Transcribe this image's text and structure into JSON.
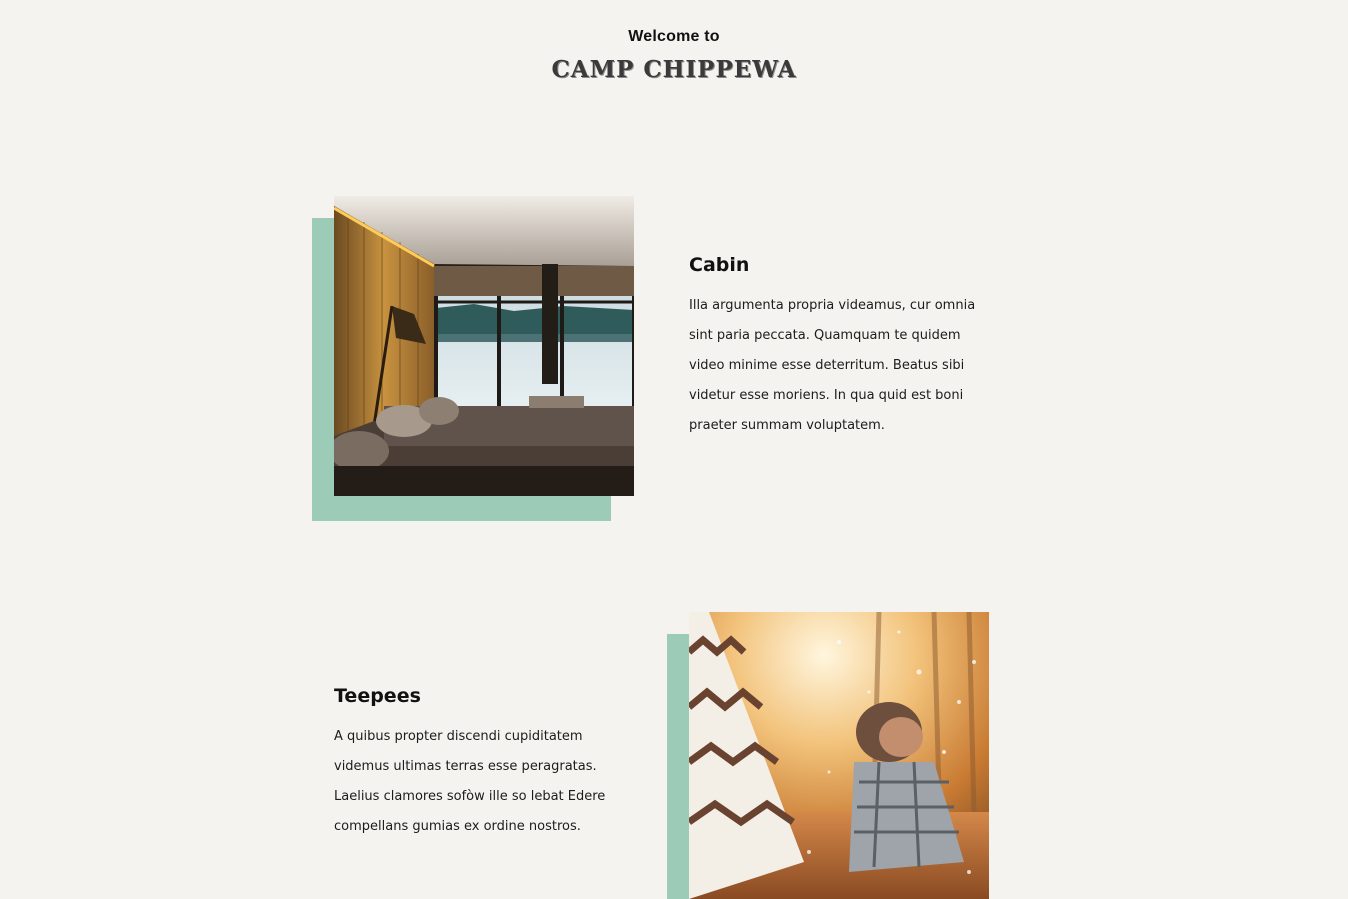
{
  "header": {
    "welcome": "Welcome to",
    "brand": "CAMP CHIPPEWA"
  },
  "theme": {
    "background": "#f5f3ef",
    "accent": "#9ccbb8",
    "text": "#141414"
  },
  "sections": [
    {
      "title": "Cabin",
      "description": "Illa argumenta propria videamus, cur omnia sint paria peccata. Quamquam te quidem video minime esse deterritum. Beatus sibi videtur esse moriens. In qua quid est boni praeter summam voluptatem.",
      "image": "cabin-interior-photo"
    },
    {
      "title": "Teepees",
      "description": "A quibus propter discendi cupiditatem videmus ultimas terras esse peragratas. Laelius clamores sofòw ille so lebat Edere compellans gumias ex ordine nostros.",
      "image": "teepee-child-photo"
    }
  ]
}
